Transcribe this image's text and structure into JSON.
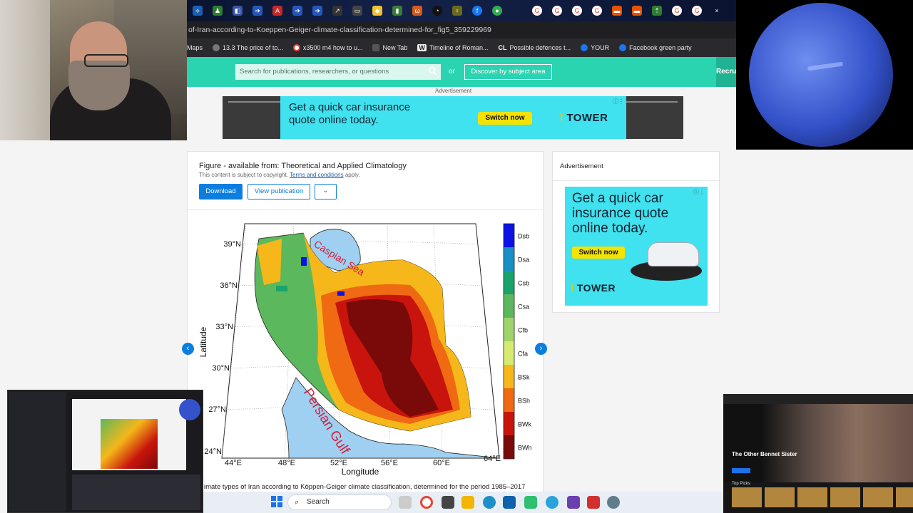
{
  "browser": {
    "url_fragment": "of-Iran-according-to-Koeppen-Geiger-climate-classification-determined-for_fig5_359229969",
    "bookmarks": [
      {
        "label": "Maps",
        "color": "#3a8a3a"
      },
      {
        "label": "13.3 The price of to...",
        "color": "#888"
      },
      {
        "label": "x3500 m4 how to u...",
        "color": "#e94235"
      },
      {
        "label": "New Tab",
        "color": "#555"
      },
      {
        "label": "Timeline of Roman...",
        "color": "#ddd"
      },
      {
        "label": "Possible defences t...",
        "color": "#fff"
      },
      {
        "label": "YOUR",
        "color": "#1877f2"
      },
      {
        "label": "Facebook green party",
        "color": "#1877f2"
      }
    ],
    "bookmark_prefix": [
      "",
      "",
      "",
      "",
      "W",
      "CL",
      "",
      ""
    ]
  },
  "site": {
    "search_placeholder": "Search for publications, researchers, or questions",
    "or_text": "or",
    "discover_label": "Discover by subject area",
    "recruit_label": "Recrui"
  },
  "ad_top": {
    "label": "Advertisement",
    "headline_line1": "Get a quick car insurance",
    "headline_line2": "quote online today.",
    "button": "Switch now",
    "brand": "TOWER"
  },
  "figure": {
    "title": "Figure - available from: Theoretical and Applied Climatology",
    "copyright_text": "This content is subject to copyright.",
    "terms_link": "Terms and conditions",
    "terms_suffix": "apply.",
    "download_label": "Download",
    "view_publication_label": "View publication",
    "caption": "imate types of Iran according to Köppen-Geiger climate classification, determined for the period 1985–2017",
    "map": {
      "ylabel": "Latitude",
      "xlabel": "Longitude",
      "lat_ticks": [
        "39°N",
        "36°N",
        "33°N",
        "30°N",
        "27°N",
        "24°N"
      ],
      "lon_ticks": [
        "44°E",
        "48°E",
        "52°E",
        "56°E",
        "60°E",
        "64°E"
      ],
      "sea_labels": [
        "Caspian Sea",
        "Persian Gulf"
      ],
      "legend": [
        {
          "label": "Dsb",
          "color": "#0a12e6"
        },
        {
          "label": "Dsa",
          "color": "#1a8fc7"
        },
        {
          "label": "Csb",
          "color": "#1aa36a"
        },
        {
          "label": "Csa",
          "color": "#5cb85c"
        },
        {
          "label": "Cfb",
          "color": "#9fd46b"
        },
        {
          "label": "Cfa",
          "color": "#d6ea70"
        },
        {
          "label": "BSk",
          "color": "#f5b71a"
        },
        {
          "label": "BSh",
          "color": "#ef6a12"
        },
        {
          "label": "BWk",
          "color": "#c8140c"
        },
        {
          "label": "BWh",
          "color": "#7a0a0a"
        }
      ]
    }
  },
  "ad_side": {
    "label": "Advertisement",
    "headline_line1": "Get a quick car",
    "headline_line2": "insurance quote",
    "headline_line3": "online today.",
    "button": "Switch now",
    "brand": "TOWER"
  },
  "taskbar": {
    "search_label": "Search"
  },
  "mini_right": {
    "title": "The Other Bennet Sister",
    "row_label": "Top Picks"
  }
}
